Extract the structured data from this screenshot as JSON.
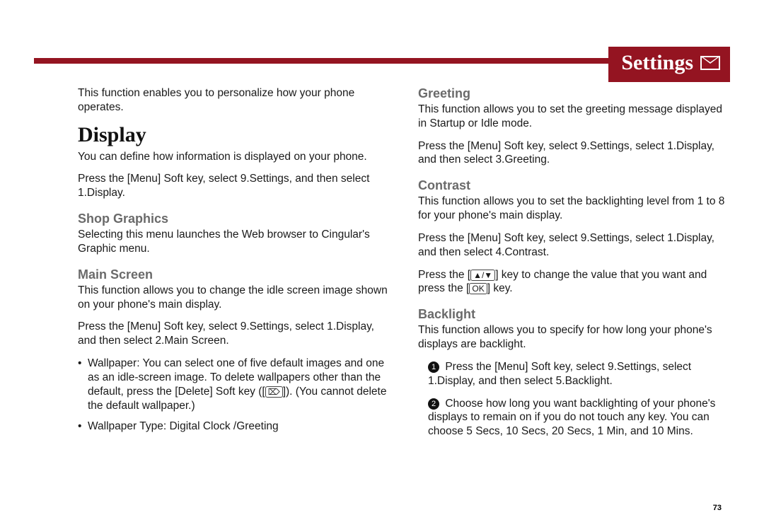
{
  "header": {
    "title": "Settings"
  },
  "intro": "This function enables you to personalize how your phone operates.",
  "display": {
    "heading": "Display",
    "p1": "You can define how information is displayed on your phone.",
    "p2": "Press the [Menu] Soft key, select 9.Settings, and then select 1.Display."
  },
  "shop": {
    "heading": "Shop Graphics",
    "p1": "Selecting this menu launches the Web browser to Cingular's Graphic menu."
  },
  "mainscreen": {
    "heading": "Main Screen",
    "p1": "This function allows you to change the idle screen image shown on your phone's main display.",
    "p2": "Press the [Menu] Soft key, select 9.Settings, select 1.Display, and then select 2.Main Screen.",
    "b1a": "Wallpaper: You can select one of five default images and one as an idle-screen image. To delete wallpapers other than the default, press the [Delete] Soft key ([",
    "b1b": "]). (You cannot delete the default wallpaper.)",
    "b2": "Wallpaper Type: Digital Clock /Greeting"
  },
  "greeting": {
    "heading": "Greeting",
    "p1": "This function allows you to set the greeting message displayed in Startup or Idle mode.",
    "p2": "Press the [Menu] Soft key, select 9.Settings, select 1.Display, and then select 3.Greeting."
  },
  "contrast": {
    "heading": "Contrast",
    "p1": "This function allows you to set the backlighting level from 1 to 8 for your phone's main display.",
    "p2": "Press the [Menu] Soft key, select 9.Settings, select 1.Display, and then select 4.Contrast.",
    "p3a": "Press the [",
    "p3b": "] key to change the value that you want and press the [",
    "p3c": "] key."
  },
  "backlight": {
    "heading": "Backlight",
    "p1": "This function allows you to specify for how long your phone's displays are backlight.",
    "s1": "Press the [Menu] Soft key, select 9.Settings, select 1.Display, and then select 5.Backlight.",
    "s2": "Choose how long you want backlighting of your phone's displays to remain on if you do not touch any key. You can choose 5 Secs, 10 Secs, 20 Secs, 1 Min, and 10 Mins."
  },
  "keys": {
    "delete": "⌦",
    "updown": "▲/▼",
    "ok": "OK"
  },
  "page_number": "73"
}
